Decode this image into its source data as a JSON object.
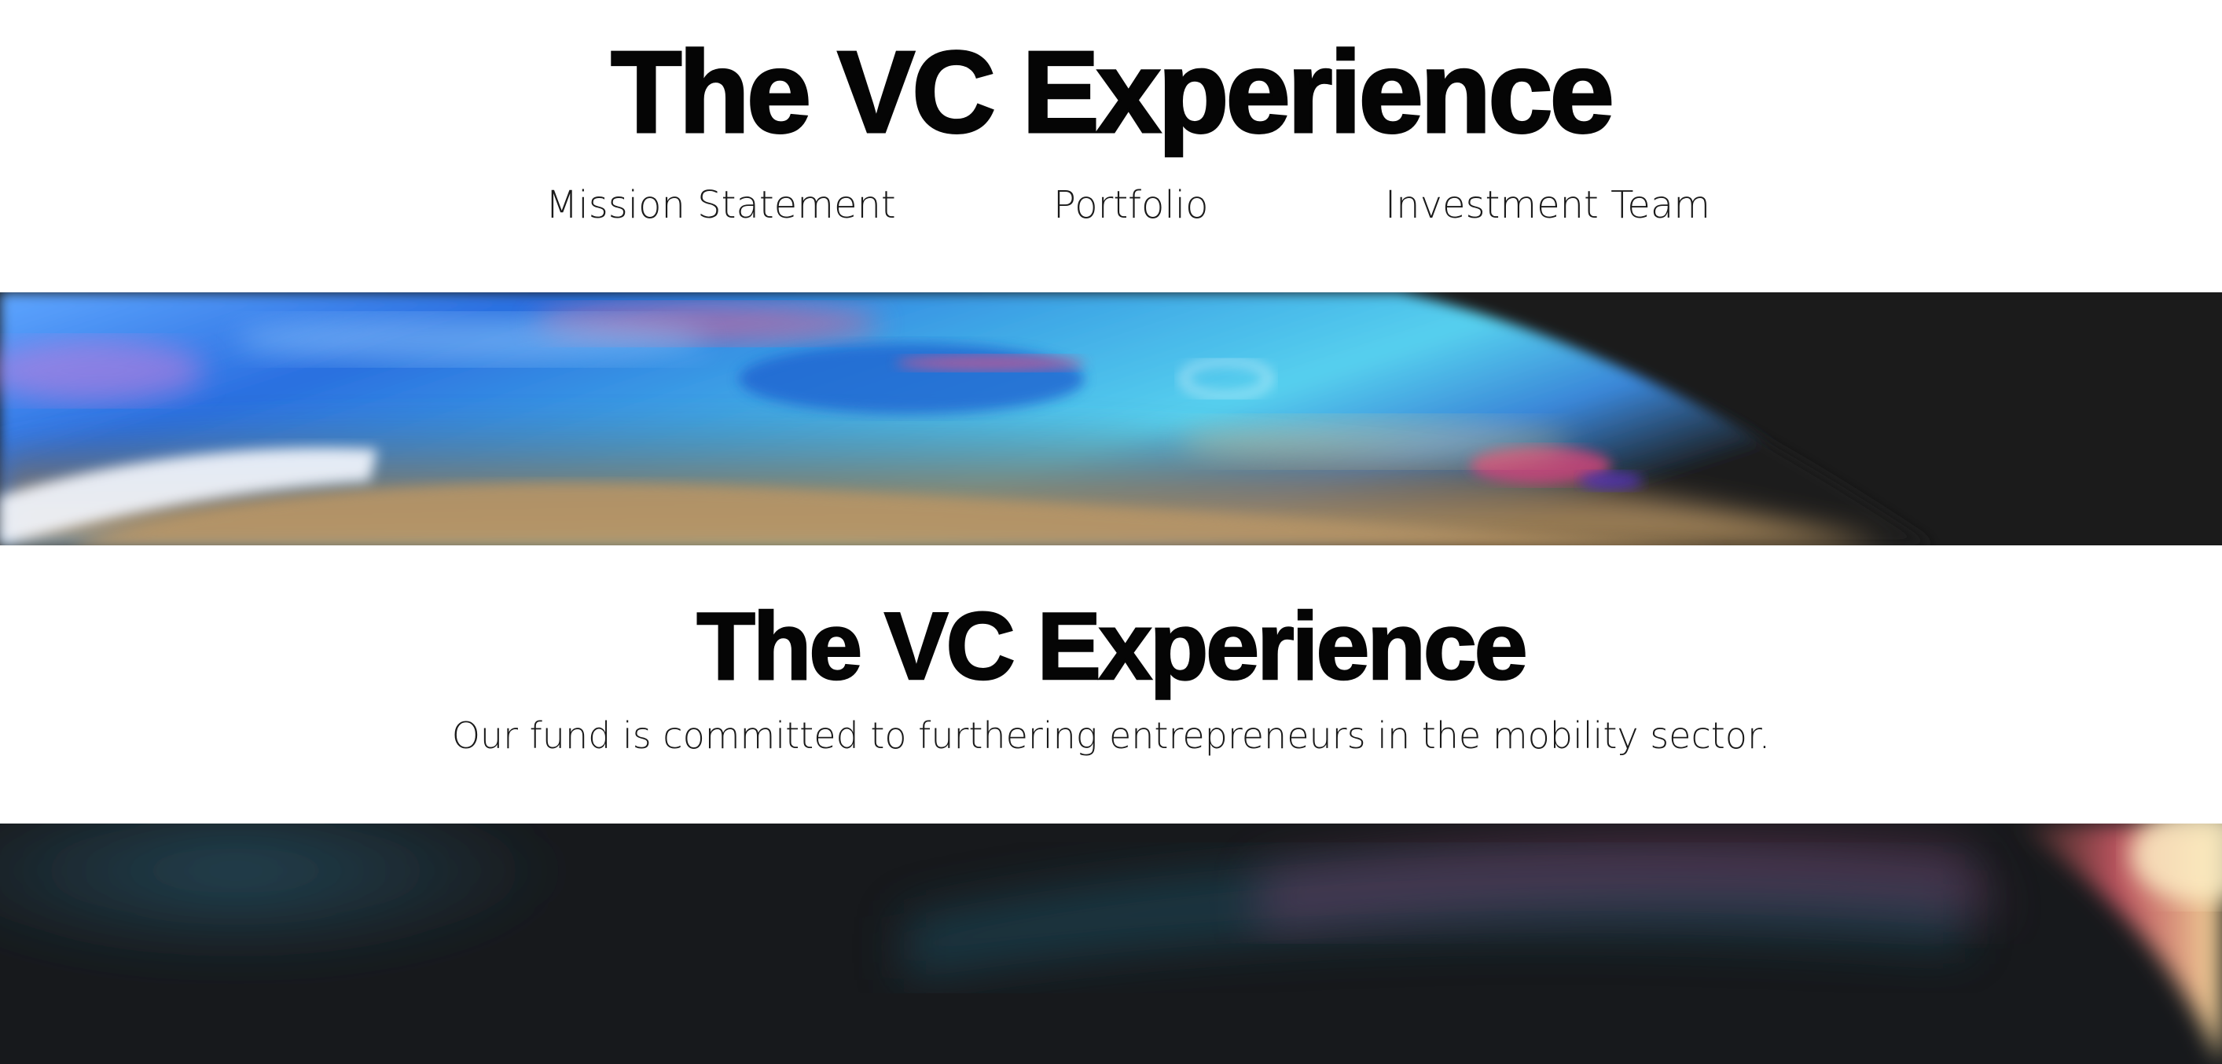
{
  "header": {
    "title": "The VC Experience",
    "nav": [
      {
        "label": "Mission Statement"
      },
      {
        "label": "Portfolio"
      },
      {
        "label": "Investment Team"
      }
    ]
  },
  "hero": {
    "title": "The VC Experience",
    "tagline": "Our fund is committed to furthering entrepreneurs in the mobility sector."
  },
  "colors": {
    "text": "#050505",
    "background": "#ffffff",
    "banner_dark": "#1b1b1b"
  }
}
